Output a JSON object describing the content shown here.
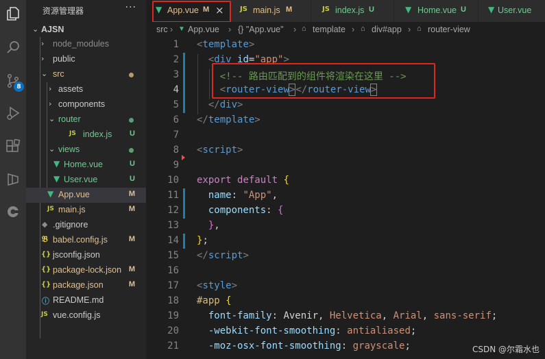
{
  "explorer": {
    "title": "资源管理器",
    "more": "···",
    "root": "AJSN",
    "items": [
      {
        "label": "node_modules",
        "status": ""
      },
      {
        "label": "public",
        "status": ""
      },
      {
        "label": "src",
        "status": ""
      },
      {
        "label": "assets",
        "status": ""
      },
      {
        "label": "components",
        "status": ""
      },
      {
        "label": "router",
        "status": ""
      },
      {
        "label": "index.js",
        "status": "U"
      },
      {
        "label": "views",
        "status": ""
      },
      {
        "label": "Home.vue",
        "status": "U"
      },
      {
        "label": "User.vue",
        "status": "U"
      },
      {
        "label": "App.vue",
        "status": "M"
      },
      {
        "label": "main.js",
        "status": "M"
      },
      {
        "label": ".gitignore",
        "status": ""
      },
      {
        "label": "babel.config.js",
        "status": "M"
      },
      {
        "label": "jsconfig.json",
        "status": ""
      },
      {
        "label": "package-lock.json",
        "status": "M"
      },
      {
        "label": "package.json",
        "status": "M"
      },
      {
        "label": "README.md",
        "status": ""
      },
      {
        "label": "vue.config.js",
        "status": ""
      }
    ]
  },
  "activity_bar": {
    "source_control_badge": "8",
    "icons": [
      "files-icon",
      "search-icon",
      "source-control-icon",
      "run-debug-icon",
      "extensions-icon",
      "remote-explorer-icon",
      "docker-icon"
    ]
  },
  "tabs": [
    {
      "label": "App.vue",
      "status": "M",
      "icon": "vue-icon",
      "active": true,
      "close": "×"
    },
    {
      "label": "main.js",
      "status": "M",
      "icon": "js-icon"
    },
    {
      "label": "index.js",
      "status": "U",
      "icon": "js-icon"
    },
    {
      "label": "Home.vue",
      "status": "U",
      "icon": "vue-icon"
    },
    {
      "label": "User.vue",
      "icon": "vue-icon"
    }
  ],
  "breadcrumb": [
    "src",
    "App.vue",
    "{} \"App.vue\"",
    "template",
    "div#app",
    "router-view"
  ],
  "editor": {
    "line_numbers": [
      "1",
      "2",
      "3",
      "4",
      "5",
      "6",
      "7",
      "8",
      "9",
      "10",
      "11",
      "12",
      "13",
      "14",
      "15",
      "16",
      "17",
      "18",
      "19",
      "20",
      "21"
    ],
    "current_line": "4",
    "lines": {
      "l1": {
        "open": "<",
        "tag": "template",
        "close": ">"
      },
      "l2": {
        "indent": "  ",
        "open": "<",
        "tag": "div",
        "attr": "id",
        "eq": "=",
        "val": "\"app\"",
        "close": ">"
      },
      "l3": {
        "indent": "    ",
        "comment": "<!-- 路由匹配到的组件将渲染在这里 -->"
      },
      "l4": {
        "indent": "    ",
        "open": "<",
        "tag": "router-view",
        "close": ">",
        "open2": "</",
        "tag2": "router-view",
        "close2": ">"
      },
      "l5": {
        "indent": "  ",
        "open": "</",
        "tag": "div",
        "close": ">"
      },
      "l6": {
        "open": "</",
        "tag": "template",
        "close": ">"
      },
      "l8": {
        "open": "<",
        "tag": "script",
        "close": ">"
      },
      "l10": {
        "kw1": "export",
        "kw2": "default",
        "brace": "{"
      },
      "l11": {
        "indent": "  ",
        "prop": "name",
        "colon": ": ",
        "val": "\"App\"",
        "comma": ","
      },
      "l12": {
        "indent": "  ",
        "prop": "components",
        "colon": ": ",
        "brace": "{"
      },
      "l13": {
        "indent": "  ",
        "brace": "}",
        "comma": ","
      },
      "l14": {
        "brace": "}",
        "semi": ";"
      },
      "l15": {
        "open": "</",
        "tag": "script",
        "close": ">"
      },
      "l17": {
        "open": "<",
        "tag": "style",
        "close": ">"
      },
      "l18": {
        "selector": "#app",
        "brace": " {"
      },
      "l19": {
        "indent": "  ",
        "prop": "font-family",
        "colon": ": ",
        "v1": "Avenir",
        "sep1": ", ",
        "v2": "Helvetica",
        "sep2": ", ",
        "v3": "Arial",
        "sep3": ", ",
        "v4": "sans-serif",
        "semi": ";"
      },
      "l20": {
        "indent": "  ",
        "prop": "-webkit-font-smoothing",
        "colon": ": ",
        "val": "antialiased",
        "semi": ";"
      },
      "l21": {
        "indent": "  ",
        "prop": "-moz-osx-font-smoothing",
        "colon": ": ",
        "val": "grayscale",
        "semi": ";"
      }
    }
  },
  "watermark": "CSDN @尔霜水也",
  "colors": {
    "highlight_box": "#e0271f",
    "vue_green": "#41b883",
    "js_yellow": "#cbcb41"
  }
}
